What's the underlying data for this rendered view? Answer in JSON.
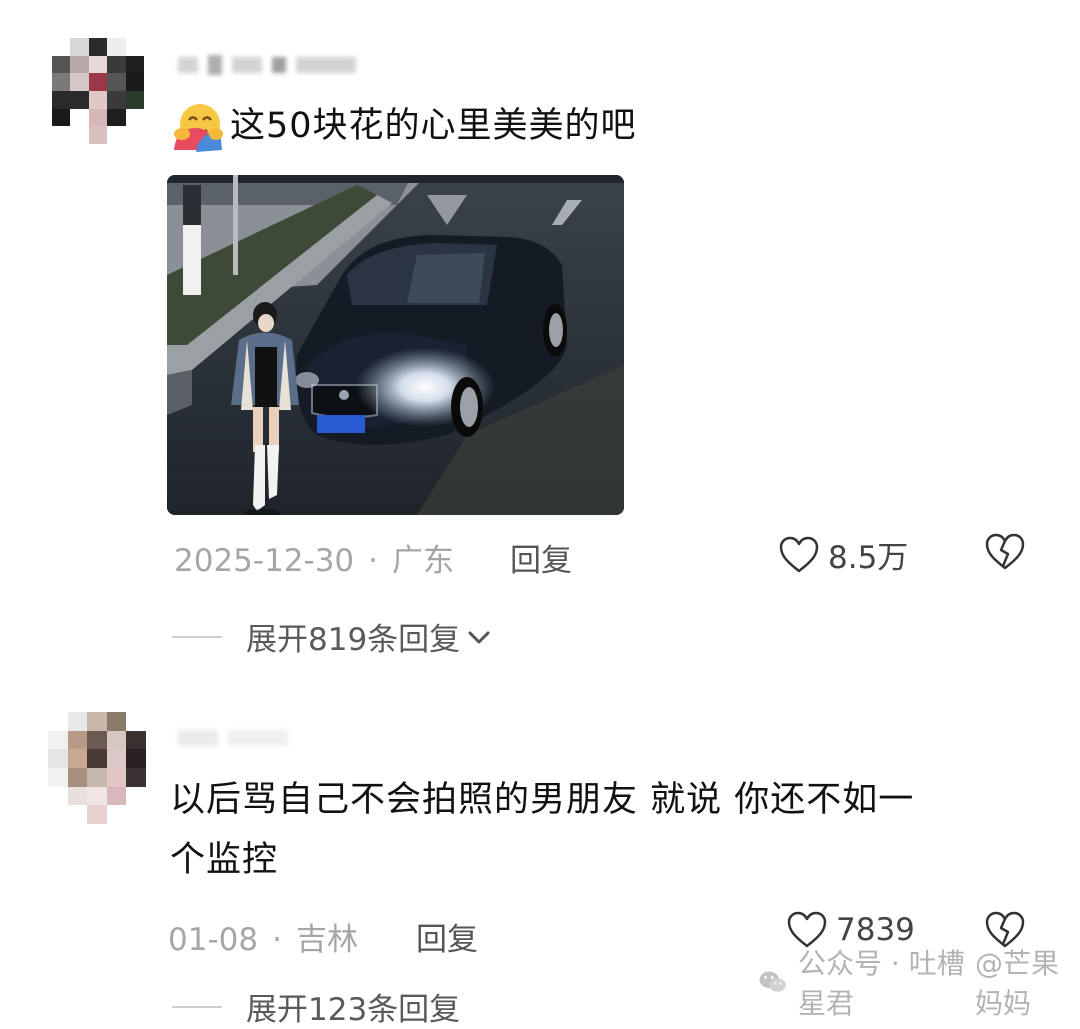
{
  "comments": [
    {
      "emoji": "hugging-face-emoji",
      "text": "这50块花的心里美美的吧",
      "date": "2025-12-30",
      "separator": "·",
      "location": "广东",
      "reply_label": "回复",
      "likes": "8.5万",
      "expand_label": "展开819条回复"
    },
    {
      "text_line1": "以后骂自己不会拍照的男朋友 就说 你还不如一",
      "text_line2": "个监控",
      "date": "01-08",
      "separator": "·",
      "location": "吉林",
      "reply_label": "回复",
      "likes": "7839",
      "expand_label": "展开123条回复"
    }
  ],
  "watermark": {
    "text1": "公众号 · 吐槽星君",
    "text2": "@芒果妈妈"
  }
}
